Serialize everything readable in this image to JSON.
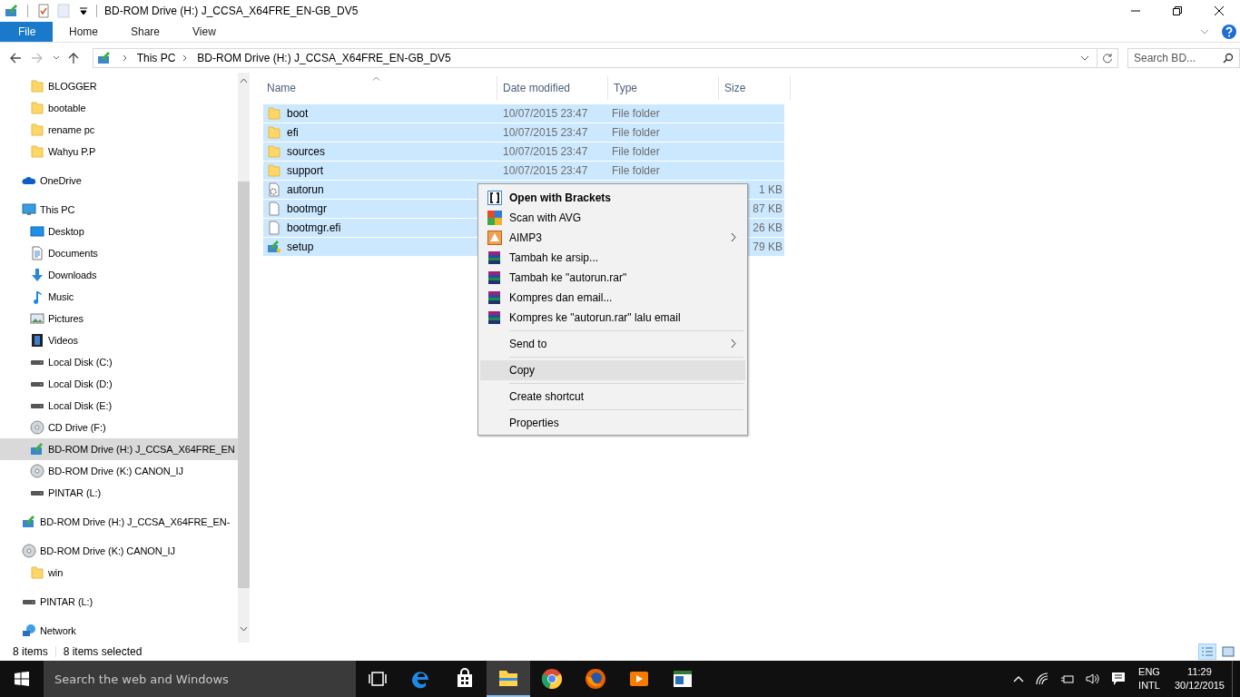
{
  "window": {
    "title": "BD-ROM Drive (H:) J_CCSA_X64FRE_EN-GB_DV5"
  },
  "ribbon": {
    "tabs": [
      {
        "label": "File",
        "kind": "file_menu"
      },
      {
        "label": "Home",
        "kind": "tab"
      },
      {
        "label": "Share",
        "kind": "tab"
      },
      {
        "label": "View",
        "kind": "tab"
      }
    ]
  },
  "address_bar": {
    "crumbs": [
      "This PC",
      "BD-ROM Drive (H:) J_CCSA_X64FRE_EN-GB_DV5"
    ]
  },
  "search": {
    "placeholder": "Search BD..."
  },
  "navigation": {
    "pinned_folders": [
      {
        "label": "BLOGGER",
        "kind": "folder",
        "selected": false
      },
      {
        "label": "bootable",
        "kind": "folder",
        "selected": false
      },
      {
        "label": "rename pc",
        "kind": "folder",
        "selected": false
      },
      {
        "label": "Wahyu P.P",
        "kind": "folder",
        "selected": false
      }
    ],
    "items": [
      {
        "label": "OneDrive",
        "kind": "cloud",
        "selected": false
      },
      {
        "label": "This PC",
        "kind": "pc",
        "selected": false,
        "children": [
          {
            "label": "Desktop",
            "kind": "desktop",
            "selected": false
          },
          {
            "label": "Documents",
            "kind": "documents",
            "selected": false
          },
          {
            "label": "Downloads",
            "kind": "downloads",
            "selected": false
          },
          {
            "label": "Music",
            "kind": "music",
            "selected": false
          },
          {
            "label": "Pictures",
            "kind": "pictures",
            "selected": false
          },
          {
            "label": "Videos",
            "kind": "videos",
            "selected": false
          },
          {
            "label": "Local Disk (C:)",
            "kind": "drive",
            "selected": false
          },
          {
            "label": "Local Disk (D:)",
            "kind": "drive",
            "selected": false
          },
          {
            "label": "Local Disk (E:)",
            "kind": "drive",
            "selected": false
          },
          {
            "label": "CD Drive (F:)",
            "kind": "cd",
            "selected": false
          },
          {
            "label": "BD-ROM Drive (H:) J_CCSA_X64FRE_EN",
            "kind": "setup_drive",
            "selected": true
          },
          {
            "label": "BD-ROM Drive (K:) CANON_IJ",
            "kind": "cd",
            "selected": false
          },
          {
            "label": "PINTAR (L:)",
            "kind": "drive",
            "selected": false
          }
        ]
      },
      {
        "label": "BD-ROM Drive (H:) J_CCSA_X64FRE_EN-",
        "kind": "setup_drive",
        "selected": false
      },
      {
        "label": "BD-ROM Drive (K:) CANON_IJ",
        "kind": "cd",
        "selected": false,
        "children": [
          {
            "label": "win",
            "kind": "folder",
            "selected": false
          }
        ]
      },
      {
        "label": "PINTAR (L:)",
        "kind": "drive",
        "selected": false
      },
      {
        "label": "Network",
        "kind": "network",
        "selected": false
      }
    ]
  },
  "file_list": {
    "columns": [
      {
        "label": "Name",
        "sorted": true
      },
      {
        "label": "Date modified",
        "sorted": false
      },
      {
        "label": "Type",
        "sorted": false
      },
      {
        "label": "Size",
        "sorted": false
      }
    ],
    "rows": [
      {
        "name": "boot",
        "kind": "folder",
        "date": "10/07/2015 23:47",
        "type": "File folder",
        "selected": true
      },
      {
        "name": "efi",
        "kind": "folder",
        "date": "10/07/2015 23:47",
        "type": "File folder",
        "selected": true
      },
      {
        "name": "sources",
        "kind": "folder",
        "date": "10/07/2015 23:47",
        "type": "File folder",
        "selected": true
      },
      {
        "name": "support",
        "kind": "folder",
        "date": "10/07/2015 23:47",
        "type": "File folder",
        "selected": true
      },
      {
        "name": "autorun",
        "kind": "settings_file",
        "size": "1 KB",
        "selected": true
      },
      {
        "name": "bootmgr",
        "kind": "file",
        "size": "87 KB",
        "selected": true
      },
      {
        "name": "bootmgr.efi",
        "kind": "file",
        "size": "26 KB",
        "selected": true
      },
      {
        "name": "setup",
        "kind": "setup",
        "size": "79 KB",
        "selected": true
      }
    ]
  },
  "context_menu": {
    "groups": [
      {
        "items": [
          {
            "label": "Open with Brackets",
            "kind": "brackets",
            "bold": true,
            "submenu": false,
            "selected": false
          },
          {
            "label": "Scan with AVG",
            "kind": "avg",
            "bold": false,
            "submenu": false,
            "selected": false
          },
          {
            "label": "AIMP3",
            "kind": "aimp",
            "bold": false,
            "submenu": true,
            "selected": false
          },
          {
            "label": "Tambah ke arsip...",
            "kind": "archive",
            "bold": false,
            "submenu": false,
            "selected": false
          },
          {
            "label": "Tambah ke \"autorun.rar\"",
            "kind": "archive",
            "bold": false,
            "submenu": false,
            "selected": false
          },
          {
            "label": "Kompres dan email...",
            "kind": "archive",
            "bold": false,
            "submenu": false,
            "selected": false
          },
          {
            "label": "Kompres ke \"autorun.rar\" lalu email",
            "kind": "archive",
            "bold": false,
            "submenu": false,
            "selected": false
          }
        ]
      },
      {
        "items": [
          {
            "label": "Send to",
            "kind": "plain",
            "bold": false,
            "submenu": true,
            "selected": false
          }
        ]
      },
      {
        "items": [
          {
            "label": "Copy",
            "kind": "plain",
            "bold": false,
            "submenu": false,
            "selected": true
          }
        ]
      },
      {
        "items": [
          {
            "label": "Create shortcut",
            "kind": "plain",
            "bold": false,
            "submenu": false,
            "selected": false
          }
        ]
      },
      {
        "items": [
          {
            "label": "Properties",
            "kind": "plain",
            "bold": false,
            "submenu": false,
            "selected": false
          }
        ]
      }
    ]
  },
  "status_bar": {
    "item_count": "8 items",
    "selection": "8 items selected"
  },
  "taskbar": {
    "search": {
      "placeholder": "Search the web and Windows"
    },
    "apps": [
      {
        "kind": "task_view",
        "selected": false
      },
      {
        "kind": "edge",
        "selected": false
      },
      {
        "kind": "store",
        "selected": false
      },
      {
        "kind": "explorer",
        "selected": true
      },
      {
        "kind": "chrome",
        "selected": false
      },
      {
        "kind": "firefox",
        "selected": false
      },
      {
        "kind": "media",
        "selected": false
      },
      {
        "kind": "window_app",
        "selected": false
      }
    ],
    "language": [
      "ENG",
      "INTL"
    ],
    "time": "11:29",
    "date": "30/12/2015"
  }
}
